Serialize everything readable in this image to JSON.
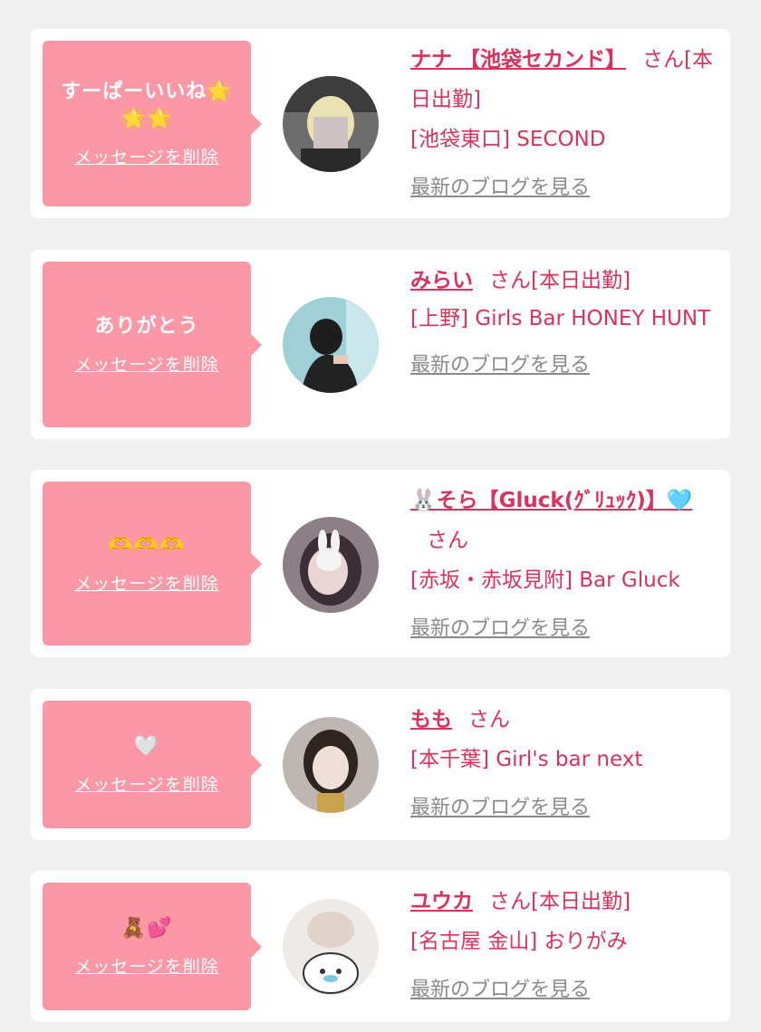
{
  "delete_label": "メッセージを削除",
  "blog_label": "最新のブログを見る",
  "san_label": "さん",
  "colors": {
    "accent": "#d9325c",
    "bubble": "#fc98a6",
    "card": "#ffffff",
    "bg": "#f0f0f1"
  },
  "items": [
    {
      "message": "すーぱーいいね🌟\n🌟🌟",
      "name": "ナナ 【池袋セカンド】",
      "status": "[本日出勤]",
      "store": "[池袋東口] SECOND"
    },
    {
      "message": "ありがとう",
      "name": "みらい",
      "status": "[本日出勤]",
      "store": "[上野] Girls Bar HONEY HUNT"
    },
    {
      "message": "🫶🫶🫶",
      "name": "🐰そら【Gluck(ｸﾞﾘｭｯｸ)】🩵",
      "status": "",
      "store": "[赤坂・赤坂見附] Bar Gluck"
    },
    {
      "message": "🤍",
      "name": "もも",
      "status": "",
      "store": "[本千葉] Girl's bar next"
    },
    {
      "message": "🧸💕",
      "name": "ユウカ",
      "status": "[本日出勤]",
      "store": "[名古屋 金山] おりがみ"
    }
  ]
}
